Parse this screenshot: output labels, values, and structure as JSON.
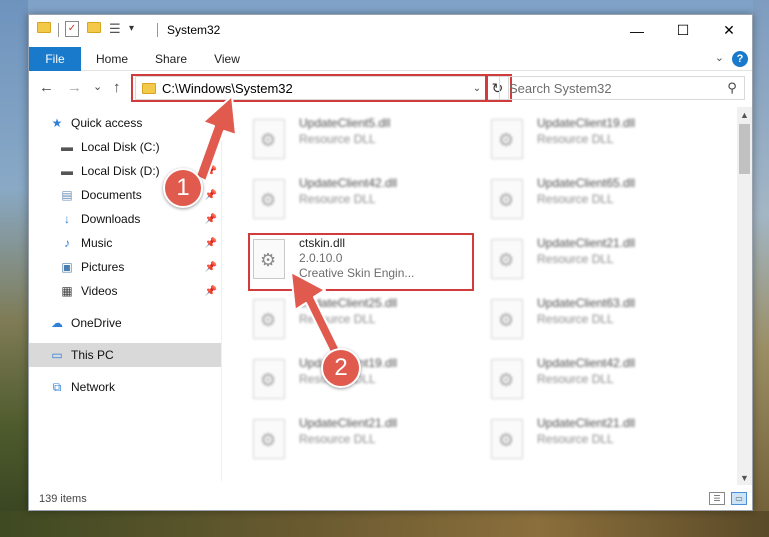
{
  "window": {
    "title": "System32",
    "minimize_glyph": "—",
    "maximize_glyph": "☐",
    "close_glyph": "✕"
  },
  "ribbon": {
    "tabs": [
      {
        "label": "File"
      },
      {
        "label": "Share"
      },
      {
        "label": "View"
      }
    ],
    "home_label": "Home",
    "help_glyph": "?"
  },
  "navbar": {
    "back_glyph": "←",
    "forward_glyph": "→",
    "recent_glyph": "⌄",
    "up_glyph": "↑",
    "address_path": "C:\\Windows\\System32",
    "refresh_glyph": "↻",
    "search_placeholder": "Search System32"
  },
  "sidebar": {
    "items": [
      {
        "label": "Quick access",
        "icon": "star-icon",
        "pinned": false
      },
      {
        "label": "Local Disk (C:)",
        "icon": "drive-icon",
        "pinned": true
      },
      {
        "label": "Local Disk (D:)",
        "icon": "drive-icon",
        "pinned": true
      },
      {
        "label": "Documents",
        "icon": "documents-icon",
        "pinned": true
      },
      {
        "label": "Downloads",
        "icon": "download-icon",
        "pinned": true
      },
      {
        "label": "Music",
        "icon": "music-icon",
        "pinned": true
      },
      {
        "label": "Pictures",
        "icon": "pictures-icon",
        "pinned": true
      },
      {
        "label": "Videos",
        "icon": "videos-icon",
        "pinned": true
      },
      {
        "label": "OneDrive",
        "icon": "cloud-icon",
        "pinned": false
      },
      {
        "label": "This PC",
        "icon": "computer-icon",
        "pinned": false,
        "selected": true
      },
      {
        "label": "Network",
        "icon": "network-icon",
        "pinned": false
      }
    ]
  },
  "files": {
    "left": [
      {
        "name": "UpdateClient5.dll",
        "type": "Resource DLL"
      },
      {
        "name": "UpdateClient42.dll",
        "type": "Resource DLL"
      },
      {
        "name": "ctskin.dll",
        "version": "2.0.10.0",
        "description": "Creative Skin Engin..."
      },
      {
        "name": "UpdateClient25.dll",
        "type": "Resource DLL"
      },
      {
        "name": "UpdateClient19.dll",
        "type": "Resource DLL"
      },
      {
        "name": "UpdateClient21.dll",
        "type": "Resource DLL"
      }
    ],
    "right": [
      {
        "name": "UpdateClient19.dll",
        "type": "Resource DLL"
      },
      {
        "name": "UpdateClient65.dll",
        "type": "Resource DLL"
      },
      {
        "name": "UpdateClient21.dll",
        "type": "Resource DLL"
      },
      {
        "name": "UpdateClient63.dll",
        "type": "Resource DLL"
      },
      {
        "name": "UpdateClient42.dll",
        "type": "Resource DLL"
      },
      {
        "name": "UpdateClient21.dll",
        "type": "Resource DLL"
      }
    ]
  },
  "status": {
    "item_count": "139 items"
  },
  "annotations": {
    "step1": "1",
    "step2": "2",
    "color": "#d23b3b"
  }
}
